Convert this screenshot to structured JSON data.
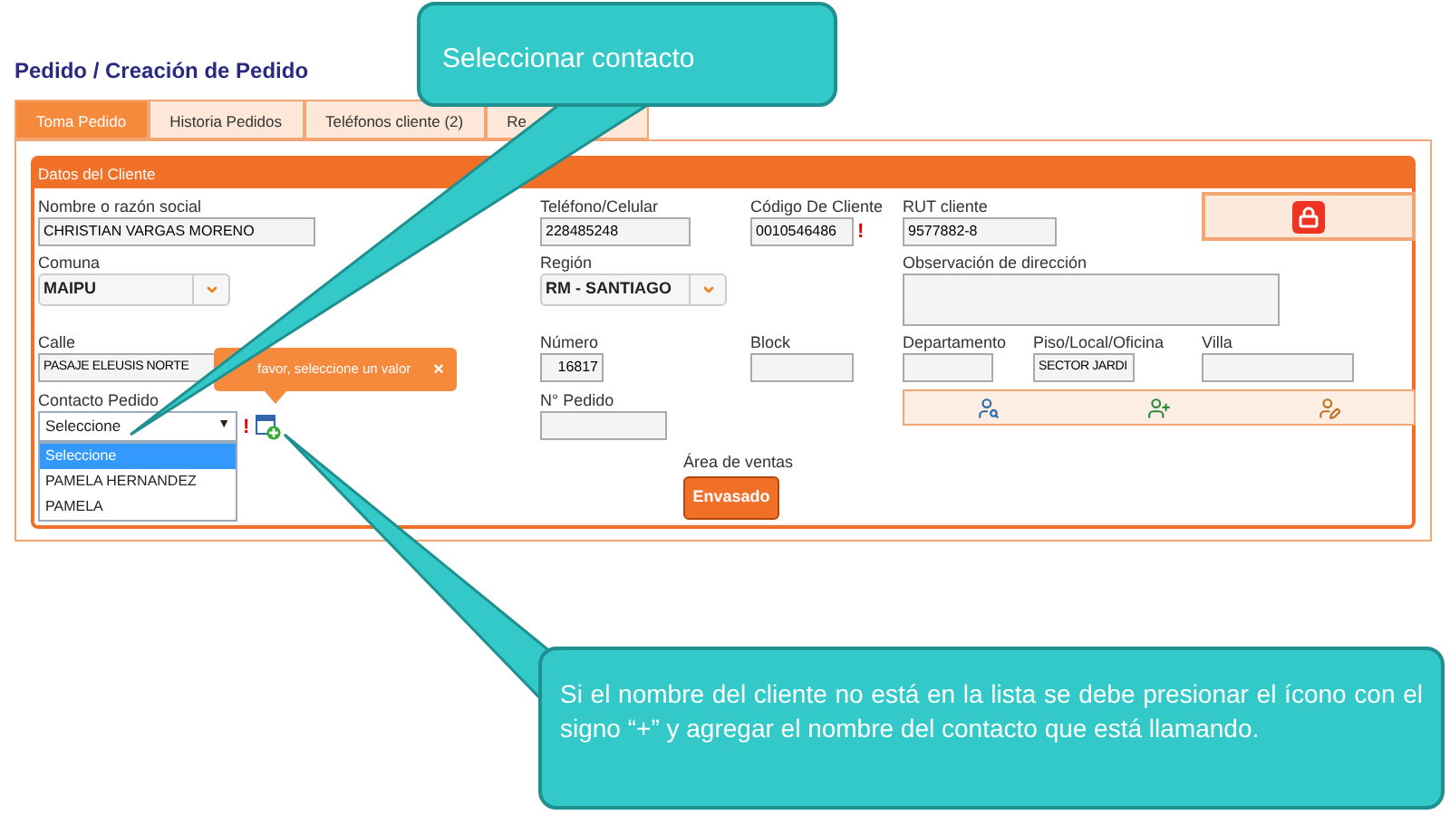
{
  "title": "Pedido / Creación de Pedido",
  "tabs": [
    {
      "label": "Toma Pedido",
      "selected": true
    },
    {
      "label": "Historia Pedidos",
      "selected": false
    },
    {
      "label": "Teléfonos cliente (2)",
      "selected": false
    },
    {
      "label": "Re",
      "selected": false
    }
  ],
  "section_title": "Datos del Cliente",
  "nombre": {
    "label": "Nombre o razón social",
    "value": "CHRISTIAN VARGAS MORENO"
  },
  "telefono": {
    "label": "Teléfono/Celular",
    "value": "228485248"
  },
  "codigo": {
    "label": "Código De Cliente",
    "value": "0010546486",
    "error_mark": "!"
  },
  "rut": {
    "label": "RUT cliente",
    "value": "9577882-8"
  },
  "comuna": {
    "label": "Comuna",
    "value": "MAIPU"
  },
  "region": {
    "label": "Región",
    "value": "RM - SANTIAGO"
  },
  "observacion": {
    "label": "Observación de dirección"
  },
  "calle": {
    "label": "Calle",
    "value": "PASAJE ELEUSIS NORTE"
  },
  "numero": {
    "label": "Número",
    "value": "16817"
  },
  "block": {
    "label": "Block"
  },
  "departamento": {
    "label": "Departamento"
  },
  "piso": {
    "label": "Piso/Local/Oficina",
    "value": "SECTOR JARDI"
  },
  "villa": {
    "label": "Villa"
  },
  "contacto": {
    "label": "Contacto Pedido",
    "value": "Seleccione",
    "arrow": "▼",
    "error_mark": "!",
    "options": [
      {
        "label": "Seleccione",
        "selected": true
      },
      {
        "label": "PAMELA HERNANDEZ",
        "selected": false
      },
      {
        "label": "PAMELA",
        "selected": false
      }
    ]
  },
  "n_pedido": {
    "label": "N° Pedido"
  },
  "area_ventas": {
    "label": "Área de ventas",
    "button": "Envasado"
  },
  "tooltip": {
    "text": "favor, seleccione un valor",
    "close": "×"
  },
  "callouts": [
    {
      "text": "Seleccionar contacto"
    },
    {
      "text": "Si el nombre del cliente no está en la lista se debe presionar el ícono con el signo “+” y agregar el nombre del contacto que está llamando."
    }
  ]
}
